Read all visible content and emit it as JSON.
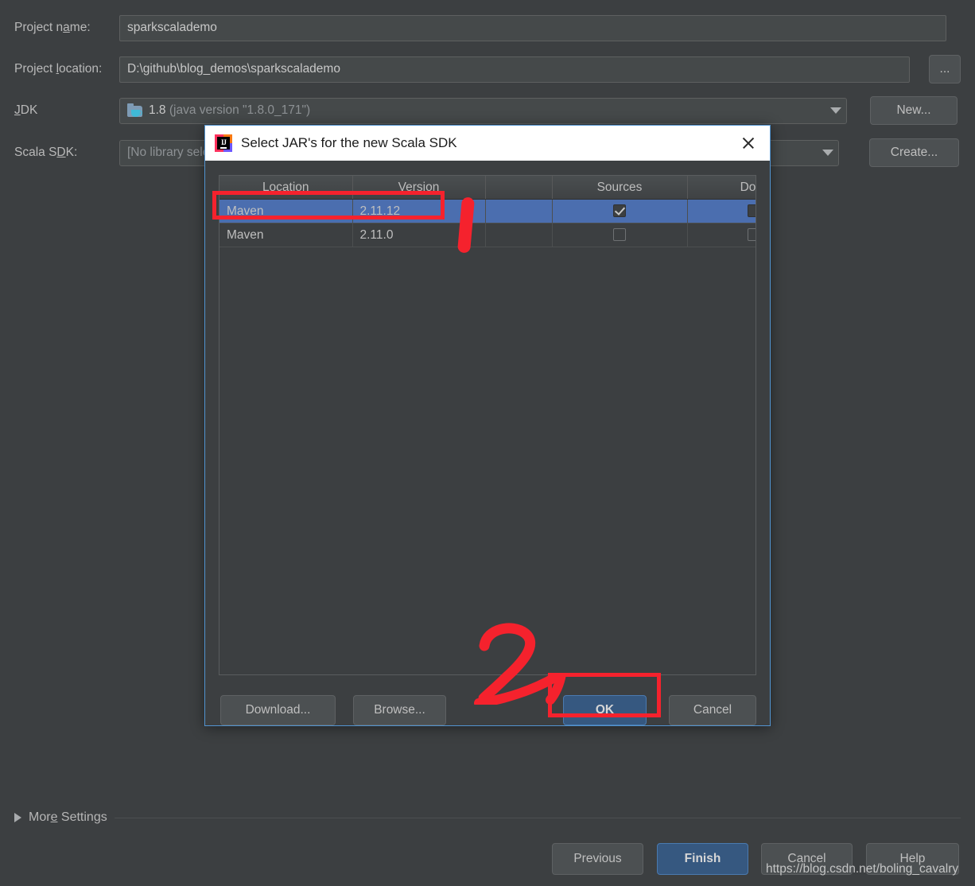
{
  "wizard": {
    "fields": [
      {
        "label_pre": "Project n",
        "label_mnemonic": "a",
        "label_post": "me:",
        "label": "Project name:",
        "value": "sparkscalademo"
      },
      {
        "label_pre": "Project ",
        "label_mnemonic": "l",
        "label_post": "ocation:",
        "label": "Project location:",
        "value": "D:\\github\\blog_demos\\sparkscalademo"
      }
    ],
    "browse_button_label": "...",
    "jdk": {
      "label_pre": "",
      "label_mnemonic": "J",
      "label_post": "DK",
      "label": "JDK",
      "value": "1.8",
      "value_detail": "(java version \"1.8.0_171\")",
      "button_label": "New...",
      "icon": "jdk-folder-icon"
    },
    "scala_sdk": {
      "label_pre": "Scala S",
      "label_mnemonic": "D",
      "label_post": "K:",
      "label": "Scala SDK:",
      "value": "[No library selected]",
      "button_label": "Create..."
    },
    "more_settings_label": "More Settings",
    "footer_buttons": [
      {
        "label": "Previous",
        "style": "ghost"
      },
      {
        "label": "Finish",
        "style": "primary"
      },
      {
        "label": "Cancel",
        "style": "ghost"
      },
      {
        "label": "Help",
        "style": "ghost"
      }
    ]
  },
  "dialog": {
    "title": "Select JAR's for the new Scala SDK",
    "icon": "intellij-idea-icon",
    "close_label": "×",
    "table": {
      "columns": [
        "Location",
        "Version",
        "",
        "Sources",
        "Docs"
      ],
      "rows": [
        {
          "location": "Maven",
          "version": "2.11.12",
          "sources_checked": true,
          "docs_checked": false,
          "selected": true
        },
        {
          "location": "Maven",
          "version": "2.11.0",
          "sources_checked": false,
          "docs_checked": false,
          "selected": false
        }
      ]
    },
    "buttons": [
      {
        "label": "Download...",
        "style": "ghost"
      },
      {
        "label": "Browse...",
        "style": "ghost"
      },
      {
        "label": "OK",
        "style": "primary"
      },
      {
        "label": "Cancel",
        "style": "ghost"
      }
    ]
  },
  "annotations": {
    "accent_color": "#f5222d",
    "step_one": "1",
    "step_two": "2"
  },
  "watermark": "https://blog.csdn.net/boling_cavalry",
  "colors": {
    "background": "#3c3f41",
    "selection": "#4b6eaf",
    "primary_button": "#365880",
    "dialog_border": "#5294d0",
    "annotation_red": "#f5222d"
  }
}
